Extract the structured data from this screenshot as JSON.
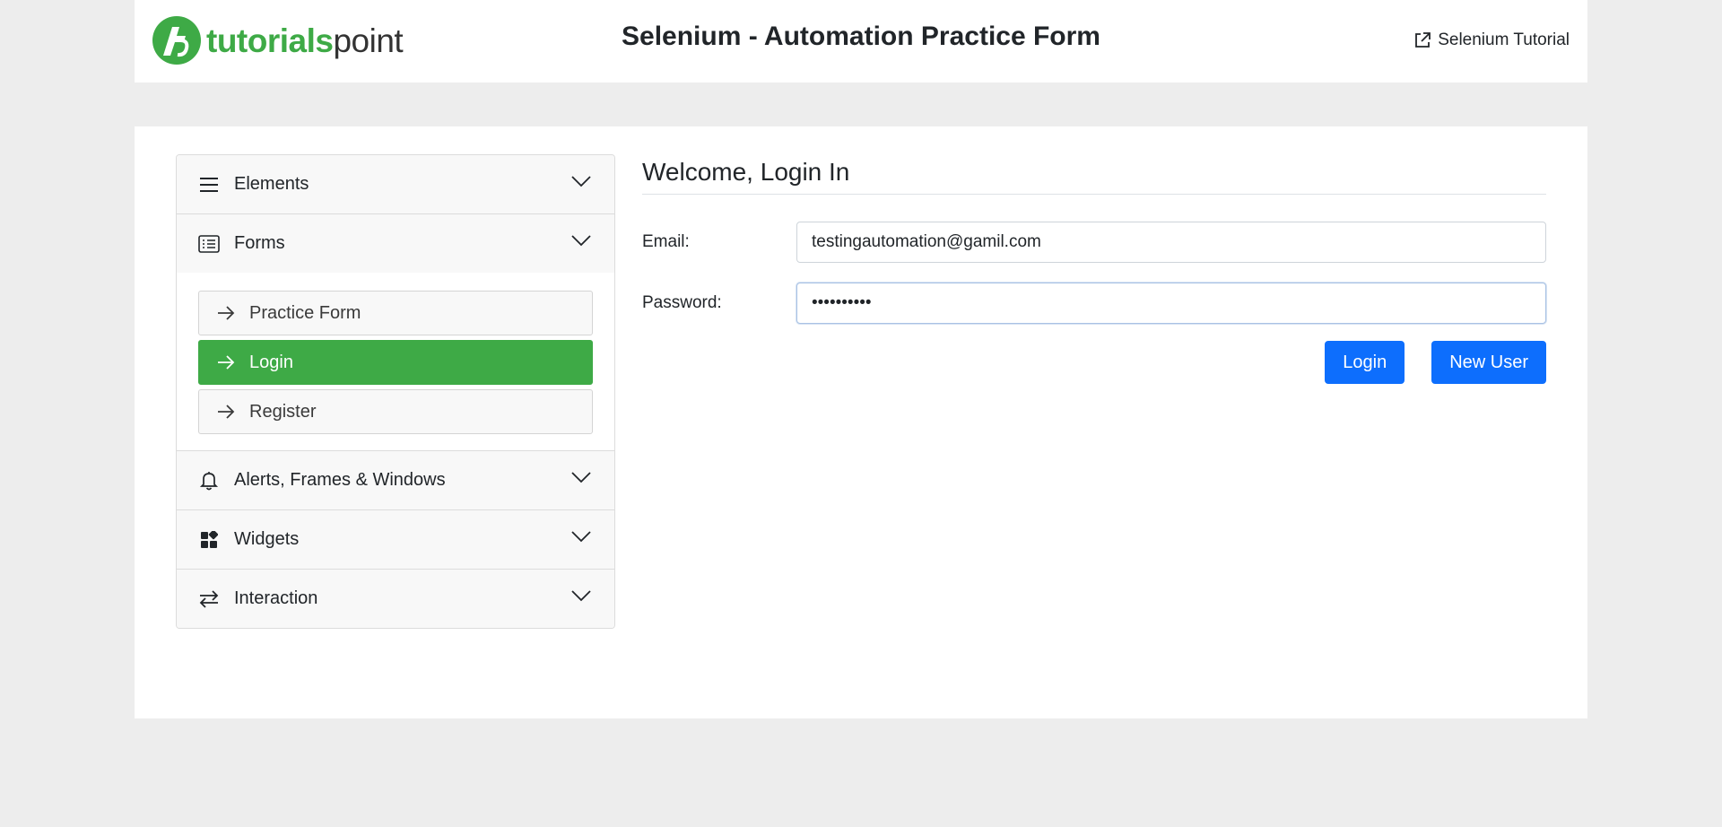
{
  "header": {
    "logo_text_bold": "tutorials",
    "logo_text_light": "point",
    "title": "Selenium - Automation Practice Form",
    "tutorial_link": "Selenium Tutorial"
  },
  "sidebar": {
    "sections": [
      {
        "label": "Elements",
        "icon": "menu-icon"
      },
      {
        "label": "Forms",
        "icon": "list-form-icon",
        "expanded": true
      },
      {
        "label": "Alerts, Frames & Windows",
        "icon": "bell-icon"
      },
      {
        "label": "Widgets",
        "icon": "widgets-icon"
      },
      {
        "label": "Interaction",
        "icon": "arrows-exchange-icon"
      }
    ],
    "forms_items": [
      {
        "label": "Practice Form"
      },
      {
        "label": "Login",
        "active": true
      },
      {
        "label": "Register"
      }
    ]
  },
  "main": {
    "heading": "Welcome, Login In",
    "email_label": "Email:",
    "email_value": "testingautomation@gamil.com",
    "password_label": "Password:",
    "password_value": "••••••••••",
    "login_button": "Login",
    "new_user_button": "New User"
  },
  "colors": {
    "brand_green": "#3eaa46",
    "primary_blue": "#0d6efd",
    "page_bg": "#ededed"
  }
}
